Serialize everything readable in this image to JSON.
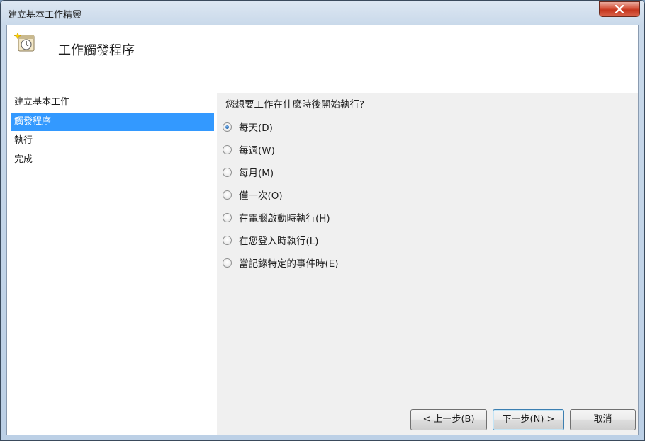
{
  "window": {
    "title": "建立基本工作精靈"
  },
  "header": {
    "title": "工作觸發程序",
    "icon": "task-scheduler-clock-icon"
  },
  "nav": {
    "items": [
      {
        "label": "建立基本工作",
        "selected": false
      },
      {
        "label": "觸發程序",
        "selected": true
      },
      {
        "label": "執行",
        "selected": false
      },
      {
        "label": "完成",
        "selected": false
      }
    ]
  },
  "main": {
    "question": "您想要工作在什麼時後開始執行?",
    "options": [
      {
        "label": "每天(D)",
        "checked": true
      },
      {
        "label": "每週(W)",
        "checked": false
      },
      {
        "label": "每月(M)",
        "checked": false
      },
      {
        "label": "僅一次(O)",
        "checked": false
      },
      {
        "label": "在電腦啟動時執行(H)",
        "checked": false
      },
      {
        "label": "在您登入時執行(L)",
        "checked": false
      },
      {
        "label": "當記錄特定的事件時(E)",
        "checked": false
      }
    ]
  },
  "buttons": {
    "back": "< 上一步(B)",
    "next": "下一步(N) >",
    "cancel": "取消"
  },
  "colors": {
    "selection": "#3399ff",
    "close_button": "#c5361e"
  }
}
